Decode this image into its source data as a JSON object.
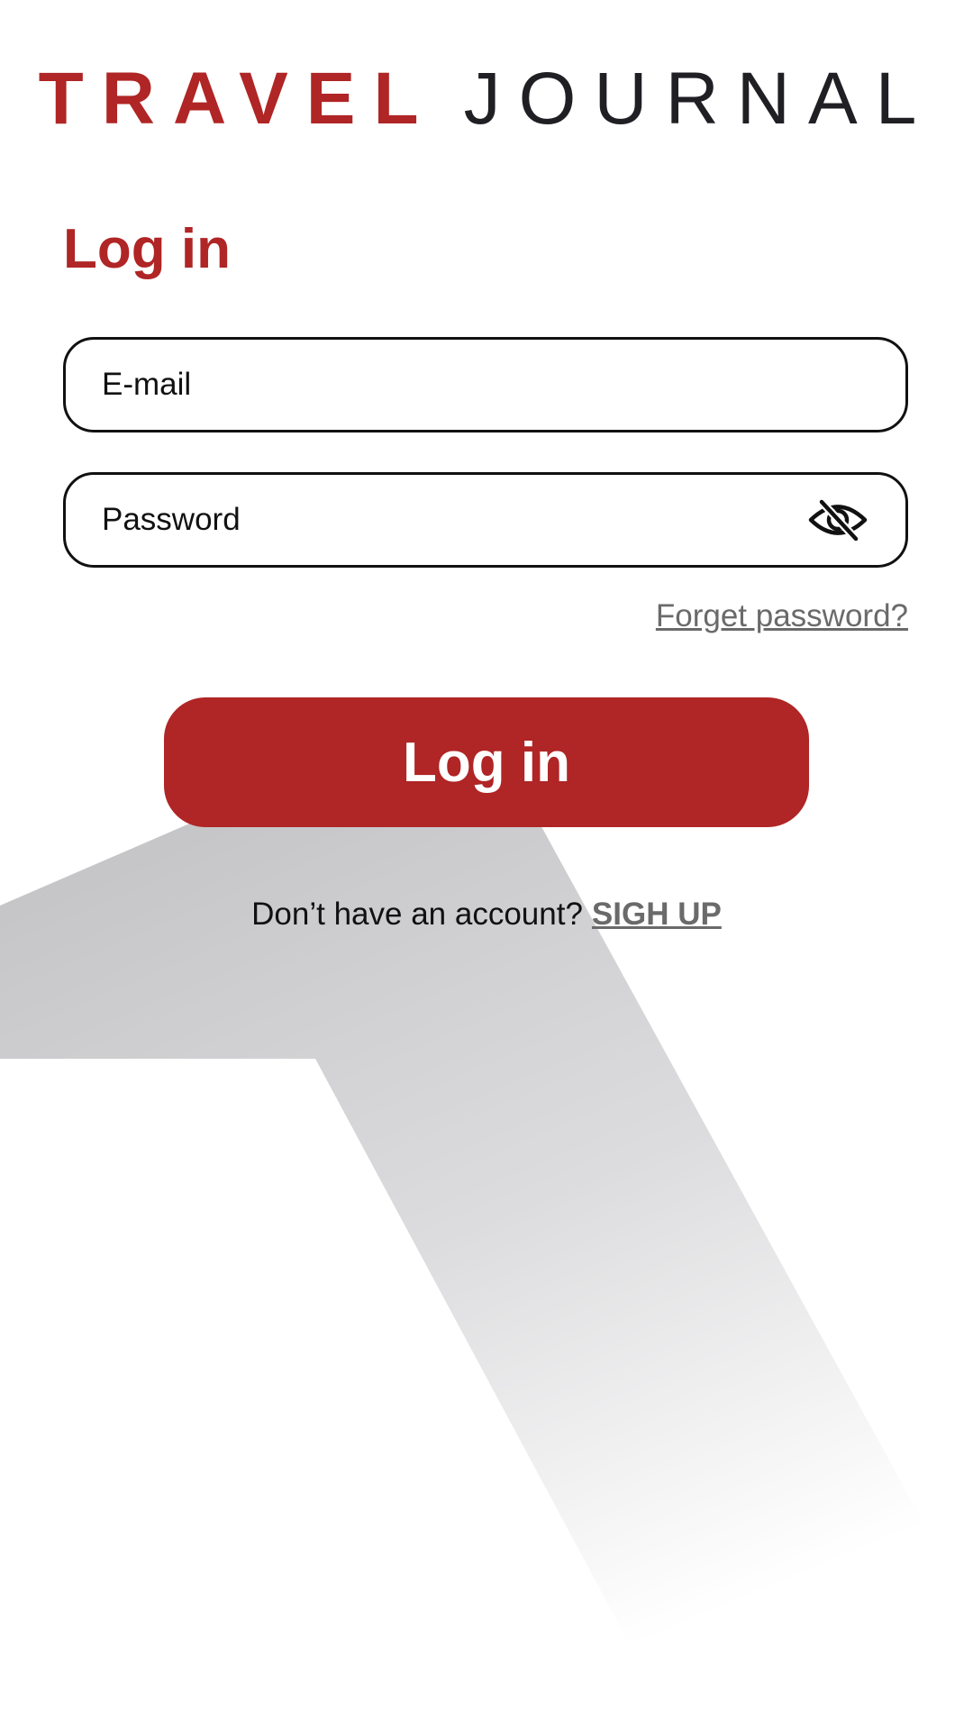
{
  "logo": {
    "word1": "TRAVEL",
    "word2": "JOURNAL"
  },
  "heading": "Log in",
  "form": {
    "email_placeholder": "E-mail",
    "email_value": "",
    "password_placeholder": "Password",
    "password_value": "",
    "password_toggle_icon": "eye-slash-icon",
    "forgot_label": "Forget password?",
    "submit_label": "Log in"
  },
  "signup": {
    "prompt": "Don’t have an account?",
    "link_label": "SIGH UP"
  },
  "colors": {
    "brand_red": "#B02525",
    "link_gray": "#6A6A6A",
    "background": "#FFFFFF",
    "decor_gray": "#C4C4C6"
  },
  "decor": {
    "background_icon": "airplane-silhouette"
  }
}
